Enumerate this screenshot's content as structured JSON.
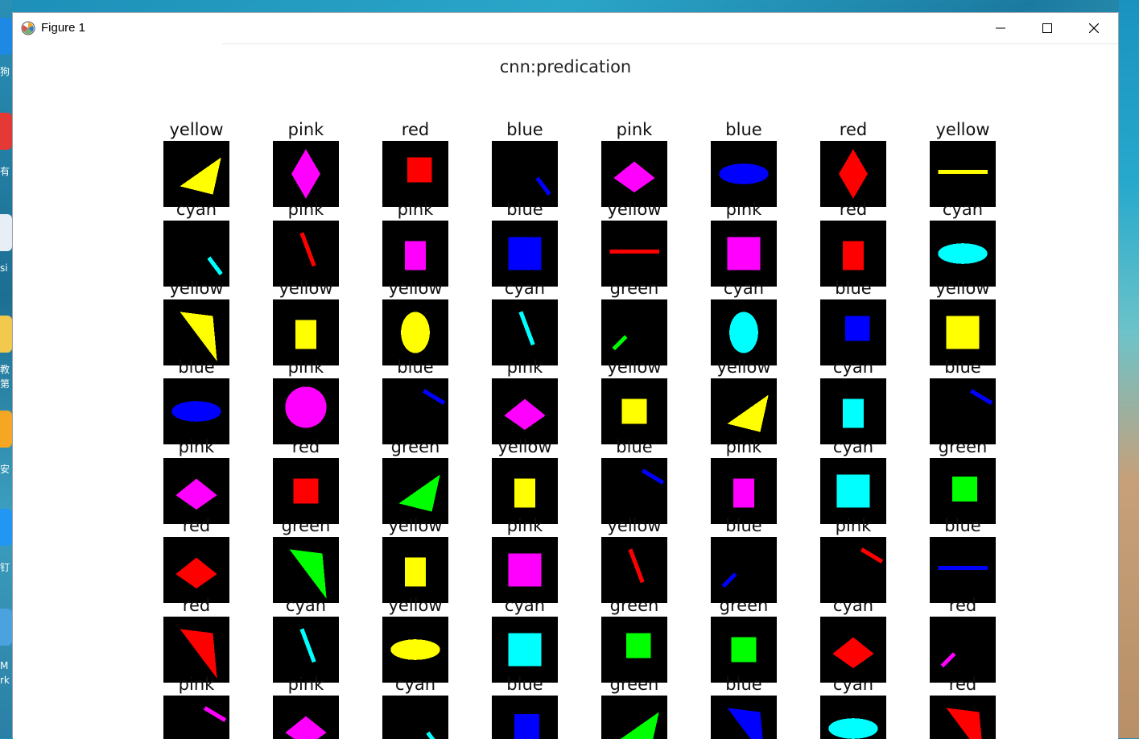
{
  "window": {
    "title": "Figure 1",
    "icon": "matplotlib-icon"
  },
  "figure": {
    "suptitle": "cnn:predication",
    "rows": [
      {
        "labels": [
          "yellow",
          "pink",
          "red",
          "blue",
          "pink",
          "blue",
          "red",
          "yellow"
        ],
        "shapes": [
          {
            "type": "triangle",
            "color": "#ffff00"
          },
          {
            "type": "diamond",
            "color": "#ff00ff"
          },
          {
            "type": "square",
            "color": "#ff0000"
          },
          {
            "type": "line",
            "color": "#0000ff"
          },
          {
            "type": "diamond",
            "color": "#ff00ff"
          },
          {
            "type": "ellipse",
            "color": "#0000ff"
          },
          {
            "type": "diamond",
            "color": "#ff0000"
          },
          {
            "type": "line",
            "color": "#ffff00"
          }
        ]
      },
      {
        "labels": [
          "cyan",
          "pink",
          "pink",
          "blue",
          "yellow",
          "pink",
          "red",
          "cyan"
        ],
        "shapes": [
          {
            "type": "line",
            "color": "#00ffff"
          },
          {
            "type": "line",
            "color": "#ff0000"
          },
          {
            "type": "rect",
            "color": "#ff00ff"
          },
          {
            "type": "rect",
            "color": "#0000ff"
          },
          {
            "type": "line",
            "color": "#ff0000"
          },
          {
            "type": "rect",
            "color": "#ff00ff"
          },
          {
            "type": "rect",
            "color": "#ff0000"
          },
          {
            "type": "ellipse",
            "color": "#00ffff"
          }
        ]
      },
      {
        "labels": [
          "yellow",
          "yellow",
          "yellow",
          "cyan",
          "green",
          "cyan",
          "blue",
          "yellow"
        ],
        "shapes": [
          {
            "type": "triangle",
            "color": "#ffff00"
          },
          {
            "type": "rect",
            "color": "#ffff00"
          },
          {
            "type": "ellipse",
            "color": "#ffff00"
          },
          {
            "type": "line",
            "color": "#00ffff"
          },
          {
            "type": "line",
            "color": "#00ff00"
          },
          {
            "type": "ellipse",
            "color": "#00ffff"
          },
          {
            "type": "square",
            "color": "#0000ff"
          },
          {
            "type": "rect",
            "color": "#ffff00"
          }
        ]
      },
      {
        "labels": [
          "blue",
          "pink",
          "blue",
          "pink",
          "yellow",
          "yellow",
          "cyan",
          "blue"
        ],
        "shapes": [
          {
            "type": "ellipse",
            "color": "#0000ff"
          },
          {
            "type": "circle",
            "color": "#ff00ff"
          },
          {
            "type": "line",
            "color": "#0000ff"
          },
          {
            "type": "diamond",
            "color": "#ff00ff"
          },
          {
            "type": "square",
            "color": "#ffff00"
          },
          {
            "type": "triangle",
            "color": "#ffff00"
          },
          {
            "type": "rect",
            "color": "#00ffff"
          },
          {
            "type": "line",
            "color": "#0000ff"
          }
        ]
      },
      {
        "labels": [
          "pink",
          "red",
          "green",
          "yellow",
          "blue",
          "pink",
          "cyan",
          "green"
        ],
        "shapes": [
          {
            "type": "diamond",
            "color": "#ff00ff"
          },
          {
            "type": "square",
            "color": "#ff0000"
          },
          {
            "type": "triangle",
            "color": "#00ff00"
          },
          {
            "type": "rect",
            "color": "#ffff00"
          },
          {
            "type": "line",
            "color": "#0000ff"
          },
          {
            "type": "rect",
            "color": "#ff00ff"
          },
          {
            "type": "rect",
            "color": "#00ffff"
          },
          {
            "type": "square",
            "color": "#00ff00"
          }
        ]
      },
      {
        "labels": [
          "red",
          "green",
          "yellow",
          "pink",
          "yellow",
          "blue",
          "pink",
          "blue"
        ],
        "shapes": [
          {
            "type": "diamond",
            "color": "#ff0000"
          },
          {
            "type": "triangle",
            "color": "#00ff00"
          },
          {
            "type": "rect",
            "color": "#ffff00"
          },
          {
            "type": "rect",
            "color": "#ff00ff"
          },
          {
            "type": "line",
            "color": "#ff0000"
          },
          {
            "type": "line",
            "color": "#0000ff"
          },
          {
            "type": "line",
            "color": "#ff0000"
          },
          {
            "type": "line",
            "color": "#0000ff"
          }
        ]
      },
      {
        "labels": [
          "red",
          "cyan",
          "yellow",
          "cyan",
          "green",
          "green",
          "cyan",
          "red"
        ],
        "shapes": [
          {
            "type": "triangle",
            "color": "#ff0000"
          },
          {
            "type": "line",
            "color": "#00ffff"
          },
          {
            "type": "ellipse",
            "color": "#ffff00"
          },
          {
            "type": "rect",
            "color": "#00ffff"
          },
          {
            "type": "square",
            "color": "#00ff00"
          },
          {
            "type": "square",
            "color": "#00ff00"
          },
          {
            "type": "diamond",
            "color": "#ff0000"
          },
          {
            "type": "line",
            "color": "#ff00ff"
          }
        ]
      },
      {
        "labels": [
          "pink",
          "pink",
          "cyan",
          "blue",
          "green",
          "blue",
          "cyan",
          "red"
        ],
        "shapes": [
          {
            "type": "line",
            "color": "#ff00ff"
          },
          {
            "type": "diamond",
            "color": "#ff00ff"
          },
          {
            "type": "line",
            "color": "#00ffff"
          },
          {
            "type": "square",
            "color": "#0000ff"
          },
          {
            "type": "triangle",
            "color": "#00ff00"
          },
          {
            "type": "triangle",
            "color": "#0000ff"
          },
          {
            "type": "ellipse",
            "color": "#00ffff"
          },
          {
            "type": "triangle",
            "color": "#ff0000"
          }
        ]
      }
    ]
  },
  "desktop": {
    "left_labels": [
      "狗",
      "有",
      "si",
      "教",
      "第",
      "安",
      "钉",
      "M",
      "rk"
    ]
  }
}
